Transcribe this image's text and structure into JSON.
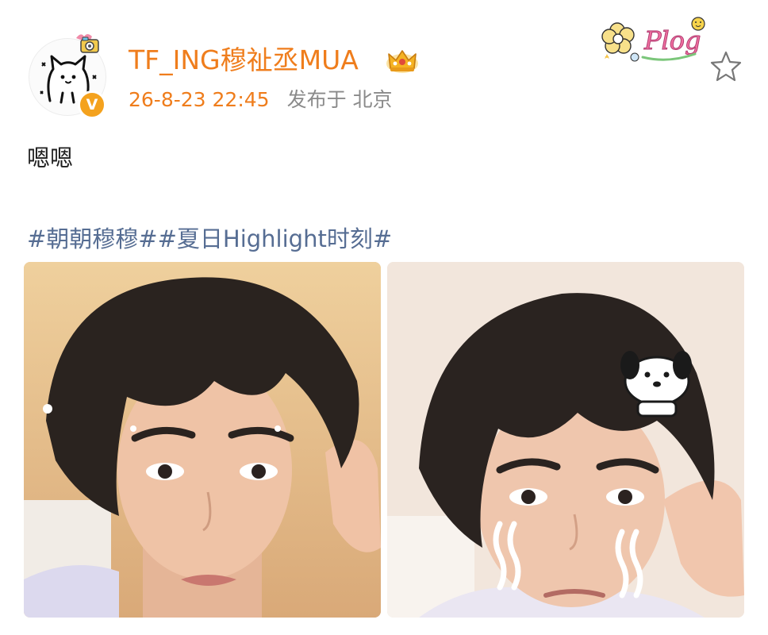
{
  "post": {
    "author": {
      "name": "TF_ING穆祉丞MUA",
      "verified_badge": "V",
      "avatar_icon": "white-cat-doodle-icon",
      "member_badge": "gold-crown-badge-icon"
    },
    "timestamp": "26-8-23 22:45",
    "location": "发布于 北京",
    "text": "嗯嗯",
    "hashtags": [
      {
        "label": "#朝朝穆穆#"
      },
      {
        "label": "#夏日Highlight时刻#"
      }
    ],
    "sticker": {
      "text": "Plog",
      "icon": "plog-flower-sticker"
    },
    "favorite_icon": "star-outline-icon",
    "images": [
      {
        "name": "selfie-photo-1"
      },
      {
        "name": "selfie-photo-2"
      }
    ]
  },
  "colors": {
    "username": "#ef7d1c",
    "timestamp": "#ef7d1c",
    "location": "#8a8a8a",
    "hashtag": "#566d93",
    "text": "#1e1e1e",
    "verified": "#f4a21e"
  }
}
